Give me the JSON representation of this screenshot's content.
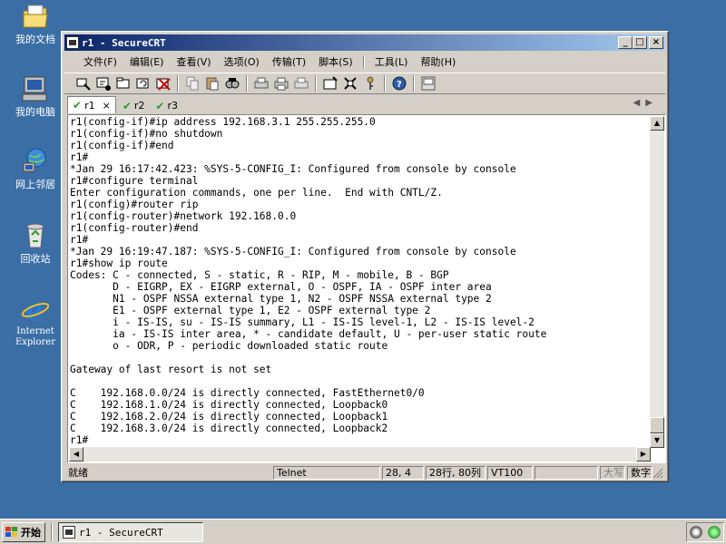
{
  "desktop": {
    "icons": [
      {
        "label": "我的文档"
      },
      {
        "label": "我的电脑"
      },
      {
        "label": "网上邻居"
      },
      {
        "label": "回收站"
      },
      {
        "label": "Internet Explorer"
      }
    ]
  },
  "window": {
    "title": "r1 - SecureCRT",
    "minimize": "_",
    "maximize": "□",
    "close": "×"
  },
  "menu": {
    "file": "文件(F)",
    "edit": "编辑(E)",
    "view": "查看(V)",
    "options": "选项(O)",
    "transfer": "传输(T)",
    "script": "脚本(S)",
    "tools": "工具(L)",
    "help": "帮助(H)"
  },
  "tabs": [
    {
      "label": "r1",
      "active": true,
      "close": "×"
    },
    {
      "label": "r2",
      "active": false
    },
    {
      "label": "r3",
      "active": false
    }
  ],
  "tab_arrows": "◀▶",
  "terminal": {
    "lines": [
      "r1(config-if)#ip address 192.168.3.1 255.255.255.0",
      "r1(config-if)#no shutdown",
      "r1(config-if)#end",
      "r1#",
      "*Jan 29 16:17:42.423: %SYS-5-CONFIG_I: Configured from console by console",
      "r1#configure terminal",
      "Enter configuration commands, one per line.  End with CNTL/Z.",
      "r1(config)#router rip",
      "r1(config-router)#network 192.168.0.0",
      "r1(config-router)#end",
      "r1#",
      "*Jan 29 16:19:47.187: %SYS-5-CONFIG_I: Configured from console by console",
      "r1#show ip route",
      "Codes: C - connected, S - static, R - RIP, M - mobile, B - BGP",
      "       D - EIGRP, EX - EIGRP external, O - OSPF, IA - OSPF inter area",
      "       N1 - OSPF NSSA external type 1, N2 - OSPF NSSA external type 2",
      "       E1 - OSPF external type 1, E2 - OSPF external type 2",
      "       i - IS-IS, su - IS-IS summary, L1 - IS-IS level-1, L2 - IS-IS level-2",
      "       ia - IS-IS inter area, * - candidate default, U - per-user static route",
      "       o - ODR, P - periodic downloaded static route",
      "",
      "Gateway of last resort is not set",
      "",
      "C    192.168.0.0/24 is directly connected, FastEthernet0/0",
      "C    192.168.1.0/24 is directly connected, Loopback0",
      "C    192.168.2.0/24 is directly connected, Loopback1",
      "C    192.168.3.0/24 is directly connected, Loopback2",
      "r1#"
    ]
  },
  "scroll": {
    "up": "▲",
    "down": "▼",
    "left": "◀",
    "right": "▶"
  },
  "status": {
    "ready": "就绪",
    "protocol": "Telnet",
    "cursor": "28, 4",
    "size": "28行, 80列",
    "emulation": "VT100",
    "blank": "",
    "caps": "大写",
    "num": "数字"
  },
  "taskbar": {
    "start": "开始",
    "task_title": "r1 - SecureCRT"
  }
}
